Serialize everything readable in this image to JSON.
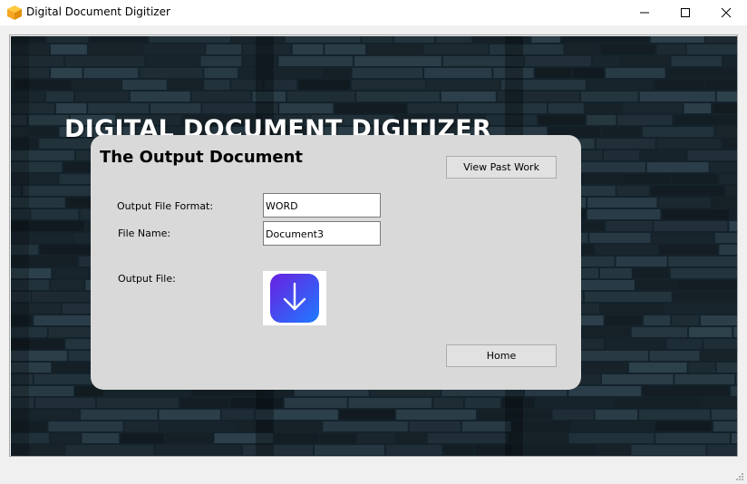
{
  "window": {
    "title": "Digital Document Digitizer",
    "icon": "app-cube-icon",
    "controls": [
      "minimize-icon",
      "maximize-icon",
      "close-icon"
    ]
  },
  "header": {
    "title": "DIGITAL DOCUMENT DIGITIZER"
  },
  "panel": {
    "title": "The Output Document",
    "view_past_work_label": "View Past Work",
    "home_label": "Home",
    "fields": {
      "format_label": "Output File Format:",
      "format_value": "WORD",
      "name_label": "File Name:",
      "name_value": "Document3",
      "output_label": "Output File:"
    },
    "download_icon": "download-arrow-icon"
  },
  "colors": {
    "panel_bg": "#d9d9d9",
    "download_gradient_start": "#6a1fe0",
    "download_gradient_end": "#1e6dff",
    "wall_base": "#1b2a33"
  }
}
